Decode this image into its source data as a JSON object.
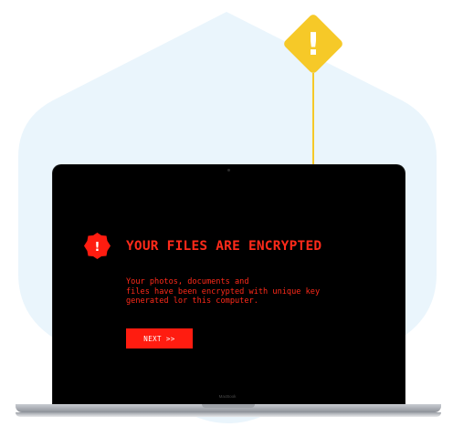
{
  "alert": {
    "title": "YOUR FILES ARE ENCRYPTED",
    "message_lines": [
      "Your photos, documents and",
      "files have been encrypted with unique key",
      "generated lor this computer."
    ],
    "next_button_label": "NEXT >>",
    "badge_glyph": "!"
  },
  "device": {
    "model_label": "MacBook"
  },
  "warning_sign": {
    "glyph": "!"
  },
  "colors": {
    "alert_red": "#ff2a1a",
    "screen_background": "#000000",
    "warning_yellow": "#f6c928",
    "backdrop_blue": "#eaf5fc"
  },
  "icons": [
    "warning-diamond-icon",
    "alert-badge-icon"
  ]
}
